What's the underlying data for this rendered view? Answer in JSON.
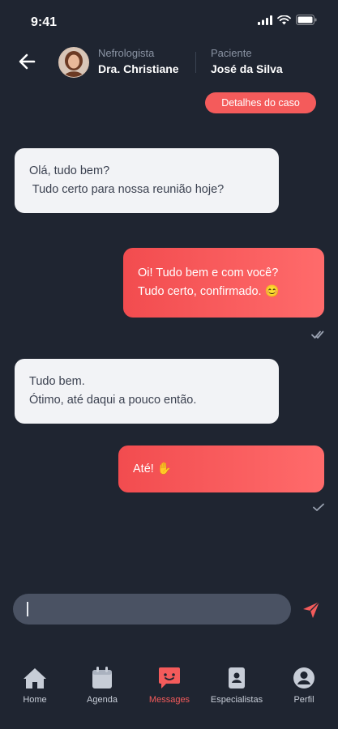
{
  "status_bar": {
    "time": "9:41"
  },
  "header": {
    "doctor_role": "Nefrologista",
    "doctor_name": "Dra. Christiane",
    "patient_role": "Paciente",
    "patient_name": "José da Silva"
  },
  "case_button_label": "Detalhes do caso",
  "messages": [
    {
      "direction": "incoming",
      "lines": [
        "Olá, tudo bem?",
        " Tudo certo para nossa reunião hoje?"
      ]
    },
    {
      "direction": "outgoing",
      "lines": [
        "Oi! Tudo bem e com você?",
        "Tudo certo, confirmado. 😊"
      ],
      "status": "read"
    },
    {
      "direction": "incoming",
      "lines": [
        "Tudo bem.",
        "Ótimo, até daqui a pouco então."
      ]
    },
    {
      "direction": "outgoing",
      "lines": [
        "Até! ✋"
      ],
      "status": "sent"
    }
  ],
  "composer": {
    "value": "",
    "placeholder": ""
  },
  "nav": {
    "items": [
      {
        "label": "Home",
        "icon": "home-icon"
      },
      {
        "label": "Agenda",
        "icon": "calendar-icon"
      },
      {
        "label": "Messages",
        "icon": "chat-icon",
        "active": true
      },
      {
        "label": "Especialistas",
        "icon": "id-card-icon"
      },
      {
        "label": "Perfil",
        "icon": "user-icon"
      }
    ]
  },
  "colors": {
    "background": "#1f2531",
    "accent": "#f45b5b",
    "incoming_bubble": "#f2f3f6",
    "composer": "#4a5263"
  }
}
